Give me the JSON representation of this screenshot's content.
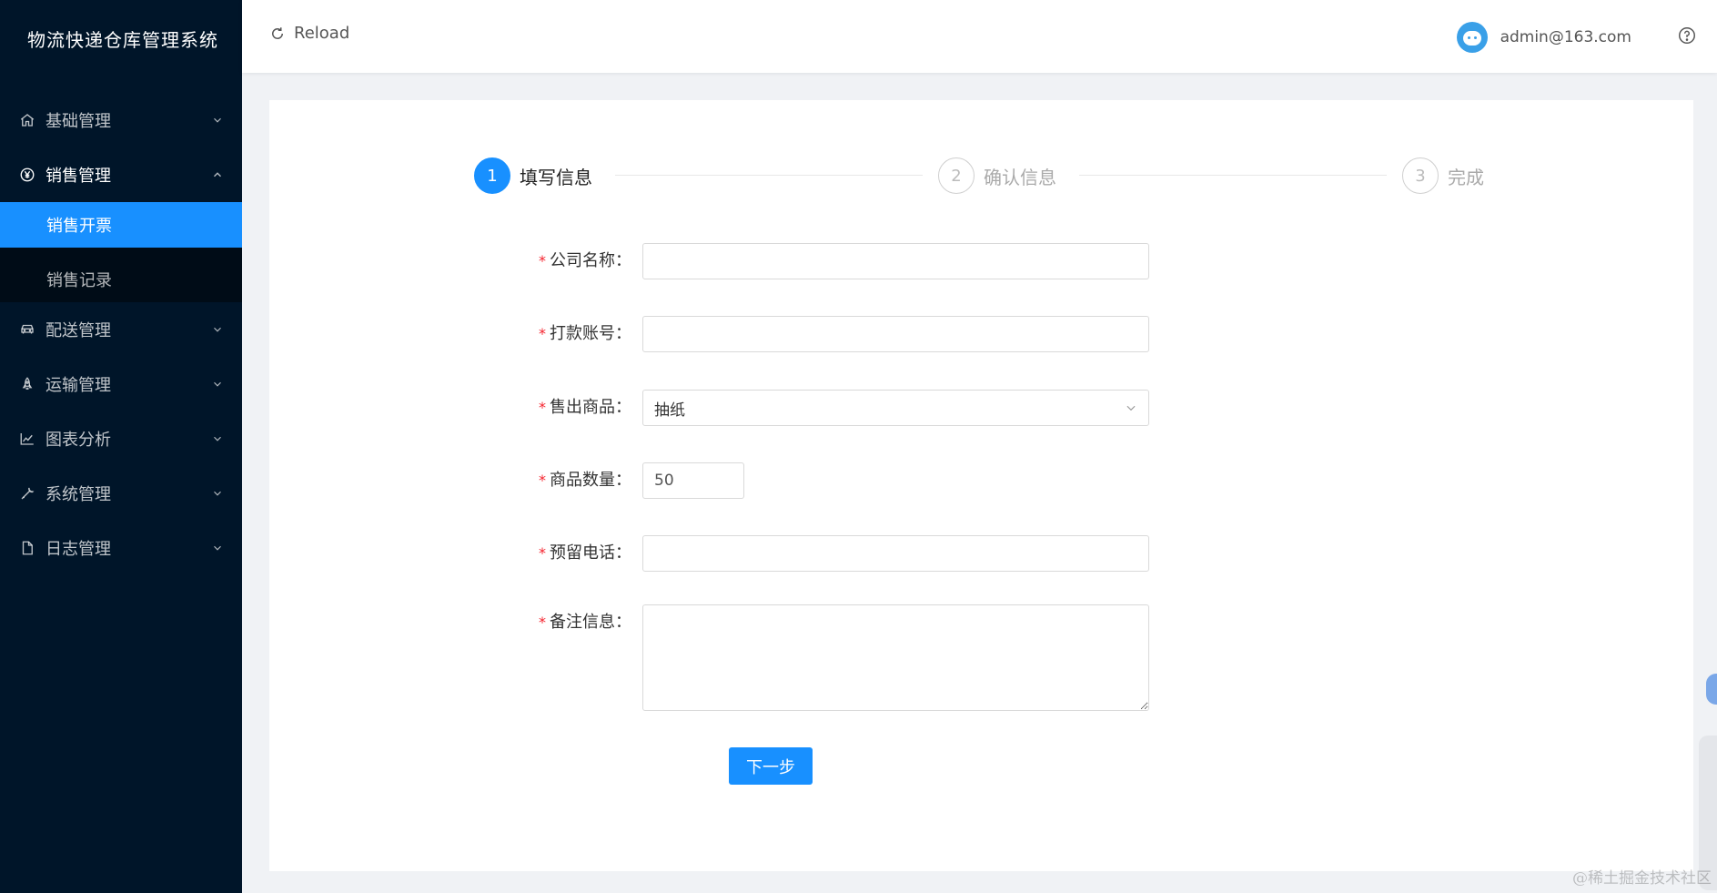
{
  "app": {
    "title": "物流快递仓库管理系统"
  },
  "sidebar": {
    "items": [
      {
        "label": "基础管理",
        "icon": "home-icon",
        "open": false
      },
      {
        "label": "销售管理",
        "icon": "yen-circle-icon",
        "open": true,
        "children": [
          {
            "label": "销售开票",
            "active": true
          },
          {
            "label": "销售记录",
            "active": false
          }
        ]
      },
      {
        "label": "配送管理",
        "icon": "car-icon",
        "open": false
      },
      {
        "label": "运输管理",
        "icon": "rocket-icon",
        "open": false
      },
      {
        "label": "图表分析",
        "icon": "line-chart-icon",
        "open": false
      },
      {
        "label": "系统管理",
        "icon": "wrench-icon",
        "open": false
      },
      {
        "label": "日志管理",
        "icon": "file-icon",
        "open": false
      }
    ]
  },
  "header": {
    "reload_label": "Reload",
    "user_email": "admin@163.com",
    "help_icon": "question-circle-icon"
  },
  "steps": [
    {
      "num": "1",
      "title": "填写信息",
      "active": true
    },
    {
      "num": "2",
      "title": "确认信息",
      "active": false
    },
    {
      "num": "3",
      "title": "完成",
      "active": false
    }
  ],
  "form": {
    "company": {
      "label": "公司名称",
      "value": ""
    },
    "account": {
      "label": "打款账号",
      "value": ""
    },
    "product": {
      "label": "售出商品",
      "value": "抽纸"
    },
    "quantity": {
      "label": "商品数量",
      "value": "50"
    },
    "phone": {
      "label": "预留电话",
      "value": ""
    },
    "remark": {
      "label": "备注信息",
      "value": ""
    },
    "next_label": "下一步"
  },
  "watermark": "@稀土掘金技术社区",
  "colors": {
    "sidebar_bg": "#001529",
    "submenu_bg": "#000c17",
    "primary": "#1890ff",
    "required": "#f5222d"
  }
}
